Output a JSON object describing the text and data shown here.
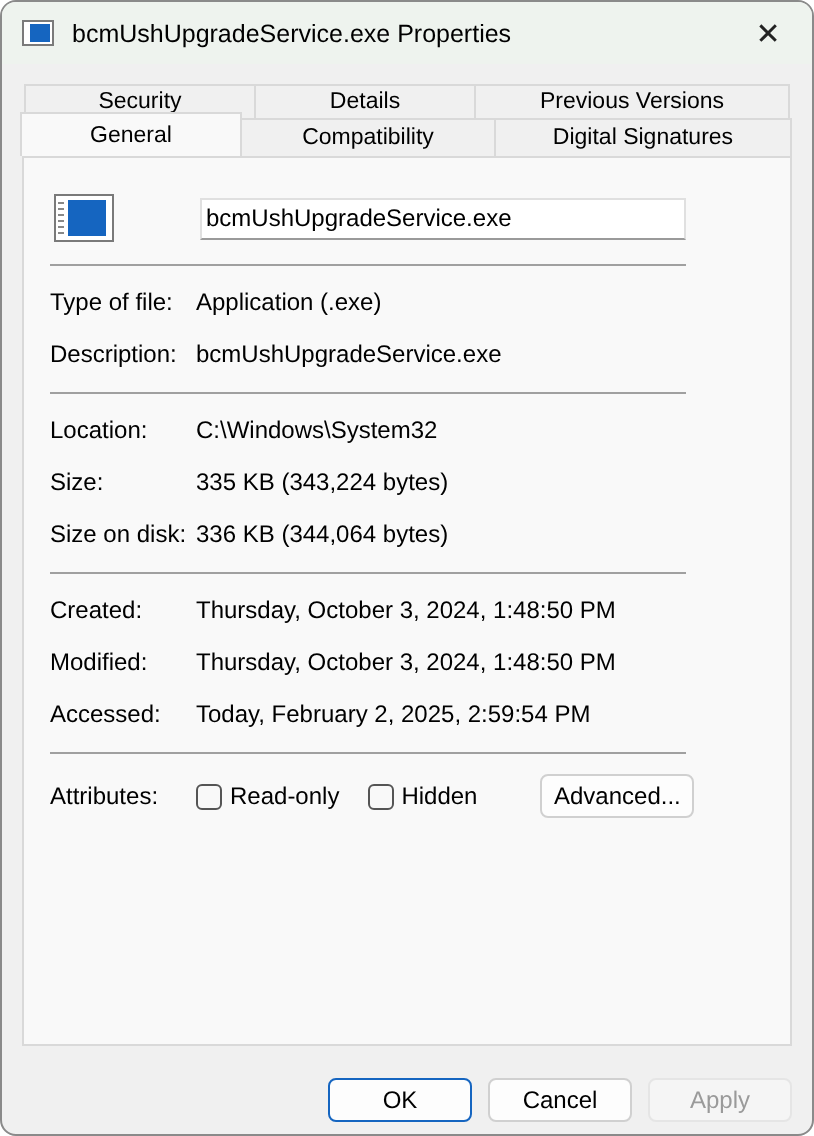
{
  "window": {
    "title": "bcmUshUpgradeService.exe Properties",
    "close": "✕"
  },
  "tab_rows": [
    [
      {
        "label": "Security",
        "selected": false
      },
      {
        "label": "Details",
        "selected": false
      },
      {
        "label": "Previous Versions",
        "selected": false
      }
    ],
    [
      {
        "label": "General",
        "selected": true
      },
      {
        "label": "Compatibility",
        "selected": false
      },
      {
        "label": "Digital Signatures",
        "selected": false
      }
    ]
  ],
  "file_name": "bcmUshUpgradeService.exe",
  "sections": [
    [
      {
        "label": "Type of file:",
        "value": "Application (.exe)"
      },
      {
        "label": "Description:",
        "value": "bcmUshUpgradeService.exe"
      }
    ],
    [
      {
        "label": "Location:",
        "value": "C:\\Windows\\System32"
      },
      {
        "label": "Size:",
        "value": "335 KB (343,224 bytes)"
      },
      {
        "label": "Size on disk:",
        "value": "336 KB (344,064 bytes)"
      }
    ],
    [
      {
        "label": "Created:",
        "value": "Thursday, October 3, 2024, 1:48:50 PM"
      },
      {
        "label": "Modified:",
        "value": "Thursday, October 3, 2024, 1:48:50 PM"
      },
      {
        "label": "Accessed:",
        "value": "Today, February 2, 2025, 2:59:54 PM"
      }
    ]
  ],
  "attributes": {
    "label": "Attributes:",
    "checkboxes": [
      {
        "label": "Read-only",
        "checked": false
      },
      {
        "label": "Hidden",
        "checked": false
      }
    ],
    "advanced": "Advanced..."
  },
  "buttons": [
    {
      "label": "OK",
      "kind": "default",
      "disabled": false
    },
    {
      "label": "Cancel",
      "kind": "normal",
      "disabled": false
    },
    {
      "label": "Apply",
      "kind": "normal",
      "disabled": true
    }
  ]
}
